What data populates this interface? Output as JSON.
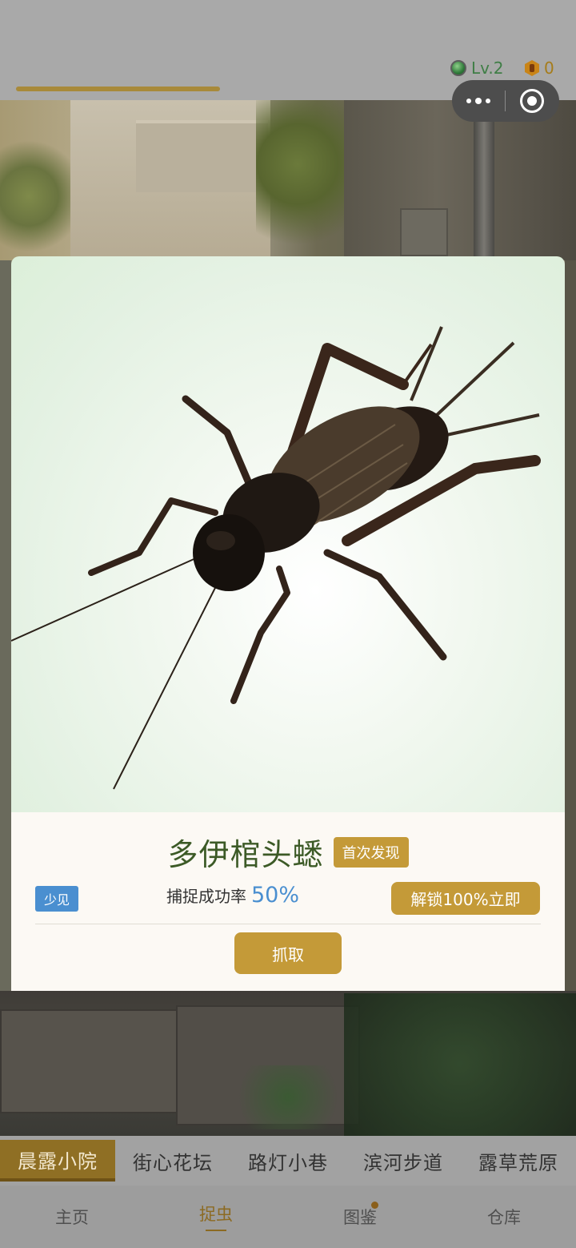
{
  "header": {
    "level": "Lv.2",
    "coins": "0",
    "capsule": {
      "more_icon": "more-dots-icon",
      "close_icon": "target-circle-icon"
    }
  },
  "card": {
    "insect_name": "多伊棺头蟋",
    "first_badge": "首次发现",
    "rarity": "少见",
    "rate_label": "捕捉成功率",
    "rate_value": "50%",
    "unlock_button": "解锁100%立即",
    "catch_button": "抓取"
  },
  "locations": {
    "tabs": [
      {
        "label": "晨露小院",
        "active": true
      },
      {
        "label": "街心花坛",
        "active": false
      },
      {
        "label": "路灯小巷",
        "active": false
      },
      {
        "label": "滨河步道",
        "active": false
      },
      {
        "label": "露草荒原",
        "active": false
      }
    ]
  },
  "nav": {
    "items": [
      {
        "label": "主页",
        "active": false
      },
      {
        "label": "捉虫",
        "active": true
      },
      {
        "label": "图鉴",
        "active": false,
        "dot": true
      },
      {
        "label": "仓库",
        "active": false
      }
    ]
  },
  "colors": {
    "accent_gold": "#c49a38",
    "name_green": "#3c5a26",
    "rate_blue": "#4a8fd0",
    "level_green": "#3f7e46",
    "coin_orange": "#a67c1a"
  }
}
